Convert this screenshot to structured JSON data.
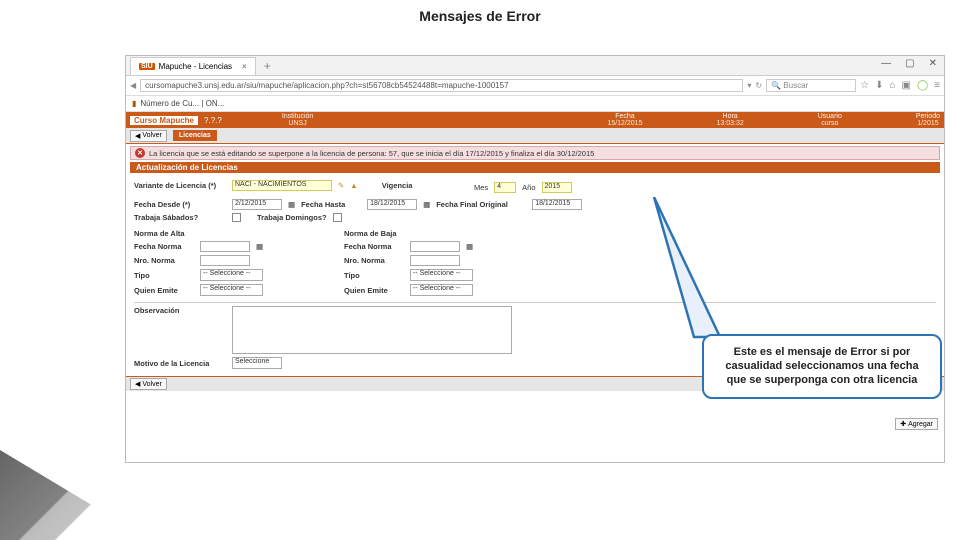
{
  "slide": {
    "title": "Mensajes de Error"
  },
  "browser": {
    "tab": {
      "badge": "SIU",
      "title": "Mapuche - Licencias"
    },
    "url": "cursomapuche3.unsj.edu.ar/siu/mapuche/aplicacion.php?ch=st56708cb54524488t=mapuche-1000157",
    "search_placeholder": "Buscar",
    "bookmark": "Número de Cu... | ON..."
  },
  "header": {
    "logo": "Curso Mapuche",
    "version": "?.?.?",
    "inst_label": "Institución",
    "inst_val": "UNSJ",
    "fecha_label": "Fecha",
    "fecha_val": "15/12/2015",
    "hora_label": "Hora",
    "hora_val": "13:03:32",
    "usuario_label": "Usuario",
    "usuario_val": "curso",
    "periodo_label": "Periodo",
    "periodo_val": "1/2015"
  },
  "topbar": {
    "volver": "Volver",
    "crumb": "Licencias"
  },
  "error": {
    "text": "La licencia que se está editando se superpone a la licencia de persona: 57, que se inicia el día 17/12/2015 y finaliza el día 30/12/2015"
  },
  "section": {
    "title": "Actualización de Licencias"
  },
  "form": {
    "variante_label": "Variante de Licencia (*)",
    "variante_val": "NACI - NACIMIENTOS",
    "vigencia_label": "Vigencia",
    "mes_label": "Mes",
    "mes_val": "4",
    "anio_label": "Año",
    "anio_val": "2015",
    "fdesde_label": "Fecha Desde (*)",
    "fdesde_val": "2/12/2015",
    "fhasta_label": "Fecha Hasta",
    "fhasta_val": "18/12/2015",
    "forig_label": "Fecha Final Original",
    "forig_val": "18/12/2015",
    "sab_label": "Trabaja Sábados?",
    "dom_label": "Trabaja Domingos?",
    "alta_title": "Norma de Alta",
    "baja_title": "Norma de Baja",
    "fnorma_label": "Fecha Norma",
    "nnorma_label": "Nro. Norma",
    "tipo_label": "Tipo",
    "tipo_val": "-- Seleccione --",
    "emite_label": "Quien Emite",
    "emite_val": "-- Seleccione --",
    "obs_label": "Observación",
    "motivo_label": "Motivo de la Licencia",
    "motivo_val": "Seleccione"
  },
  "buttons": {
    "agregar": "Agregar",
    "volver2": "Volver"
  },
  "callout": {
    "text": "Este es el mensaje de Error si por casualidad seleccionamos una fecha que se superponga con otra licencia"
  }
}
